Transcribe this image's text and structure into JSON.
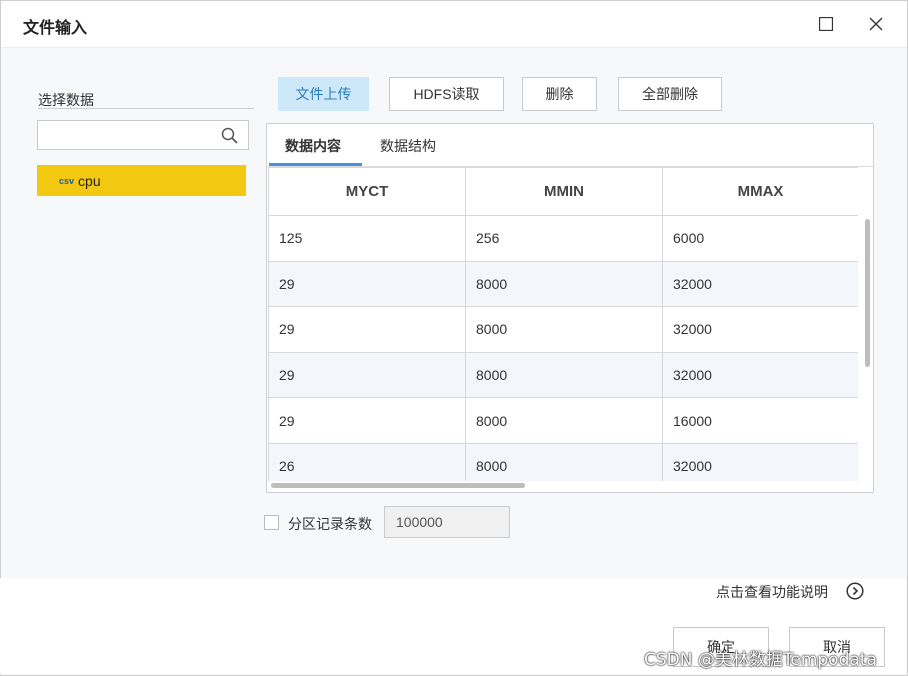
{
  "window": {
    "title": "文件输入"
  },
  "left": {
    "section_label": "选择数据",
    "search_placeholder": "",
    "files": [
      {
        "type_tag": "csv",
        "name": "cpu"
      }
    ]
  },
  "toolbar": {
    "upload_label": "文件上传",
    "hdfs_label": "HDFS读取",
    "delete_label": "删除",
    "delete_all_label": "全部删除"
  },
  "tabs": [
    {
      "label": "数据内容"
    },
    {
      "label": "数据结构"
    }
  ],
  "table": {
    "columns": [
      "MYCT",
      "MMIN",
      "MMAX"
    ],
    "rows": [
      [
        "125",
        "256",
        "6000"
      ],
      [
        "29",
        "8000",
        "32000"
      ],
      [
        "29",
        "8000",
        "32000"
      ],
      [
        "29",
        "8000",
        "32000"
      ],
      [
        "29",
        "8000",
        "16000"
      ],
      [
        "26",
        "8000",
        "32000"
      ]
    ]
  },
  "partition": {
    "label": "分区记录条数",
    "value": "100000",
    "checked": false
  },
  "footer": {
    "help_text": "点击查看功能说明",
    "ok_label": "确定",
    "cancel_label": "取消"
  },
  "watermark": "CSDN @美林数据Tempodata",
  "colors": {
    "accent": "#f2c811",
    "primary_btn_bg": "#cde8f8",
    "tab_underline": "#4a90d9"
  }
}
